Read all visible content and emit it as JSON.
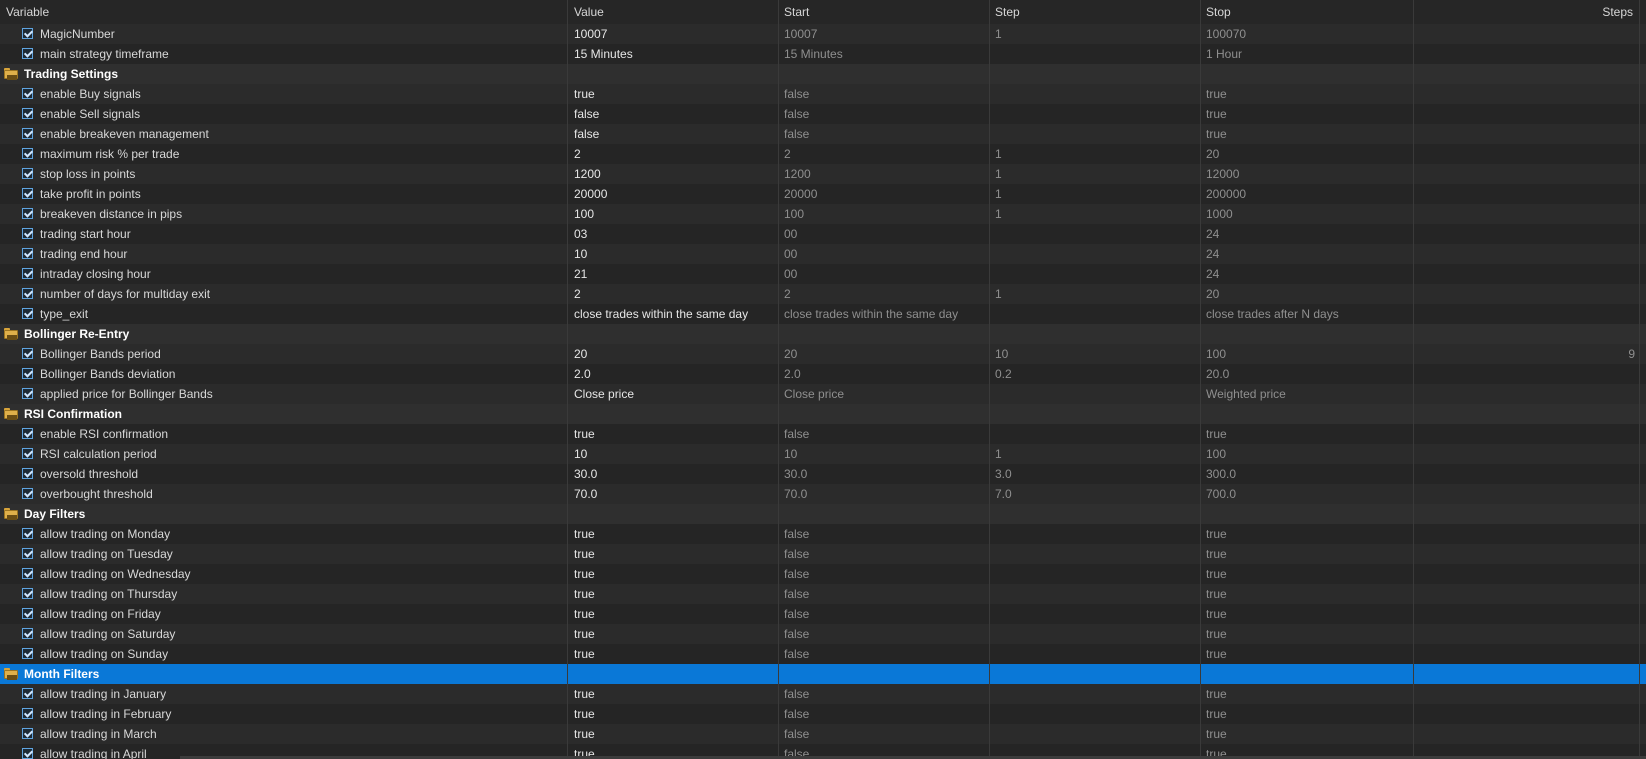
{
  "columns": {
    "variable": "Variable",
    "value": "Value",
    "start": "Start",
    "step": "Step",
    "stop": "Stop",
    "steps": "Steps"
  },
  "rows": [
    {
      "type": "param",
      "name": "MagicNumber",
      "value": "10007",
      "start": "10007",
      "step": "1",
      "stop": "100070",
      "steps": ""
    },
    {
      "type": "param",
      "name": "main strategy timeframe",
      "value": "15 Minutes",
      "start": "15 Minutes",
      "step": "",
      "stop": "1 Hour",
      "steps": ""
    },
    {
      "type": "group",
      "name": "Trading Settings"
    },
    {
      "type": "param",
      "name": "enable Buy signals",
      "value": "true",
      "start": "false",
      "step": "",
      "stop": "true",
      "steps": ""
    },
    {
      "type": "param",
      "name": "enable Sell signals",
      "value": "false",
      "start": "false",
      "step": "",
      "stop": "true",
      "steps": ""
    },
    {
      "type": "param",
      "name": "enable breakeven management",
      "value": "false",
      "start": "false",
      "step": "",
      "stop": "true",
      "steps": ""
    },
    {
      "type": "param",
      "name": "maximum risk % per trade",
      "value": "2",
      "start": "2",
      "step": "1",
      "stop": "20",
      "steps": ""
    },
    {
      "type": "param",
      "name": "stop loss in points",
      "value": "1200",
      "start": "1200",
      "step": "1",
      "stop": "12000",
      "steps": ""
    },
    {
      "type": "param",
      "name": "take profit in points",
      "value": "20000",
      "start": "20000",
      "step": "1",
      "stop": "200000",
      "steps": ""
    },
    {
      "type": "param",
      "name": "breakeven distance in pips",
      "value": "100",
      "start": "100",
      "step": "1",
      "stop": "1000",
      "steps": ""
    },
    {
      "type": "param",
      "name": "trading start hour",
      "value": "03",
      "start": "00",
      "step": "",
      "stop": "24",
      "steps": ""
    },
    {
      "type": "param",
      "name": "trading end hour",
      "value": "10",
      "start": "00",
      "step": "",
      "stop": "24",
      "steps": ""
    },
    {
      "type": "param",
      "name": "intraday closing hour",
      "value": "21",
      "start": "00",
      "step": "",
      "stop": "24",
      "steps": ""
    },
    {
      "type": "param",
      "name": "number of days for multiday exit",
      "value": "2",
      "start": "2",
      "step": "1",
      "stop": "20",
      "steps": ""
    },
    {
      "type": "param",
      "name": "type_exit",
      "value": "close trades within the same day",
      "start": "close trades within the same day",
      "step": "",
      "stop": "close trades after N days",
      "steps": ""
    },
    {
      "type": "group",
      "name": "Bollinger Re-Entry"
    },
    {
      "type": "param",
      "name": "Bollinger Bands period",
      "value": "20",
      "start": "20",
      "step": "10",
      "stop": "100",
      "steps": "9"
    },
    {
      "type": "param",
      "name": "Bollinger Bands deviation",
      "value": "2.0",
      "start": "2.0",
      "step": "0.2",
      "stop": "20.0",
      "steps": ""
    },
    {
      "type": "param",
      "name": "applied price for Bollinger Bands",
      "value": "Close price",
      "start": "Close price",
      "step": "",
      "stop": "Weighted price",
      "steps": ""
    },
    {
      "type": "group",
      "name": "RSI Confirmation"
    },
    {
      "type": "param",
      "name": "enable RSI confirmation",
      "value": "true",
      "start": "false",
      "step": "",
      "stop": "true",
      "steps": ""
    },
    {
      "type": "param",
      "name": "RSI calculation period",
      "value": "10",
      "start": "10",
      "step": "1",
      "stop": "100",
      "steps": ""
    },
    {
      "type": "param",
      "name": "oversold threshold",
      "value": "30.0",
      "start": "30.0",
      "step": "3.0",
      "stop": "300.0",
      "steps": ""
    },
    {
      "type": "param",
      "name": "overbought threshold",
      "value": "70.0",
      "start": "70.0",
      "step": "7.0",
      "stop": "700.0",
      "steps": ""
    },
    {
      "type": "group",
      "name": "Day Filters"
    },
    {
      "type": "param",
      "name": "allow trading on Monday",
      "value": "true",
      "start": "false",
      "step": "",
      "stop": "true",
      "steps": ""
    },
    {
      "type": "param",
      "name": "allow trading on Tuesday",
      "value": "true",
      "start": "false",
      "step": "",
      "stop": "true",
      "steps": ""
    },
    {
      "type": "param",
      "name": "allow trading on Wednesday",
      "value": "true",
      "start": "false",
      "step": "",
      "stop": "true",
      "steps": ""
    },
    {
      "type": "param",
      "name": "allow trading on Thursday",
      "value": "true",
      "start": "false",
      "step": "",
      "stop": "true",
      "steps": ""
    },
    {
      "type": "param",
      "name": "allow trading on Friday",
      "value": "true",
      "start": "false",
      "step": "",
      "stop": "true",
      "steps": ""
    },
    {
      "type": "param",
      "name": "allow trading on Saturday",
      "value": "true",
      "start": "false",
      "step": "",
      "stop": "true",
      "steps": ""
    },
    {
      "type": "param",
      "name": "allow trading on Sunday",
      "value": "true",
      "start": "false",
      "step": "",
      "stop": "true",
      "steps": ""
    },
    {
      "type": "group",
      "name": "Month Filters",
      "selected": true
    },
    {
      "type": "param",
      "name": "allow trading in January",
      "value": "true",
      "start": "false",
      "step": "",
      "stop": "true",
      "steps": ""
    },
    {
      "type": "param",
      "name": "allow trading in February",
      "value": "true",
      "start": "false",
      "step": "",
      "stop": "true",
      "steps": ""
    },
    {
      "type": "param",
      "name": "allow trading in March",
      "value": "true",
      "start": "false",
      "step": "",
      "stop": "true",
      "steps": ""
    },
    {
      "type": "param",
      "name": "allow trading in April",
      "value": "true",
      "start": "false",
      "step": "",
      "stop": "true",
      "steps": ""
    }
  ],
  "icons": {
    "group": "folder-icon",
    "param": "checkbox-checked-icon"
  },
  "colors": {
    "selection": "#0a78d7",
    "background": "#222222",
    "checkbox": "#5fa4e0",
    "folder": "#e0b04a"
  }
}
